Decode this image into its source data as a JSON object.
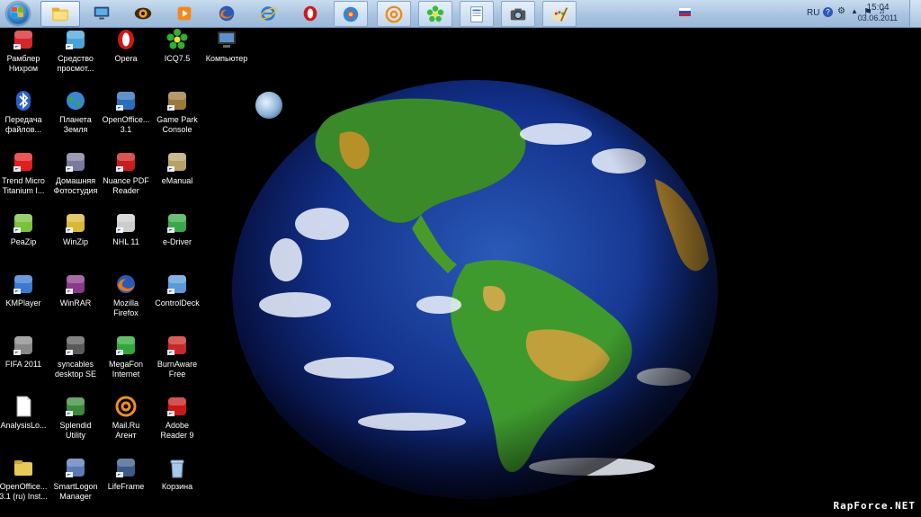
{
  "taskbar": {
    "pinned": [
      {
        "name": "explorer",
        "icon": "folder-icon"
      },
      {
        "name": "display",
        "icon": "monitor-icon"
      },
      {
        "name": "eye",
        "icon": "eye-icon"
      },
      {
        "name": "media",
        "icon": "media-player-icon"
      },
      {
        "name": "firefox",
        "icon": "firefox-icon"
      },
      {
        "name": "ie",
        "icon": "internet-explorer-icon"
      },
      {
        "name": "opera",
        "icon": "opera-icon"
      },
      {
        "name": "games",
        "icon": "game-center-icon"
      },
      {
        "name": "mail",
        "icon": "at-sign-icon"
      },
      {
        "name": "icq",
        "icon": "icq-flower-icon"
      },
      {
        "name": "document",
        "icon": "document-icon"
      },
      {
        "name": "camera",
        "icon": "camera-icon"
      },
      {
        "name": "paint",
        "icon": "palette-icon"
      }
    ]
  },
  "tray": {
    "language": "RU",
    "time": "15:04",
    "date": "03.06.2011"
  },
  "desktop": {
    "icons": [
      {
        "label": "Рамблер\nНихром",
        "icon": "rambler-icon",
        "color": "#d7262a"
      },
      {
        "label": "Средство\nпросмот...",
        "icon": "photo-viewer-icon",
        "color": "#4aa3d8"
      },
      {
        "label": "Opera",
        "icon": "opera-icon",
        "color": "#d01818"
      },
      {
        "label": "ICQ7.5",
        "icon": "icq-flower-icon",
        "color": "#2fb12f"
      },
      {
        "label": "Компьютер",
        "icon": "computer-icon",
        "color": "#5e8fc8"
      },
      {
        "label": "Передача\nфайлов...",
        "icon": "bluetooth-icon",
        "color": "#2a62c8"
      },
      {
        "label": "Планета\nЗемля",
        "icon": "globe-icon",
        "color": "#3a86d6"
      },
      {
        "label": "OpenOffice...\n3.1",
        "icon": "openoffice-icon",
        "color": "#2b6fb8"
      },
      {
        "label": "Game Park\nConsole",
        "icon": "gamepad-icon",
        "color": "#9a7a3a"
      },
      {
        "label": "Trend Micro\nTitanium I...",
        "icon": "trend-micro-icon",
        "color": "#e02020"
      },
      {
        "label": "Домашняя\nФотостудия",
        "icon": "camera-icon",
        "color": "#7a7a9a"
      },
      {
        "label": "Nuance PDF\nReader",
        "icon": "pdf-reader-icon",
        "color": "#c81e1e"
      },
      {
        "label": "eManual",
        "icon": "manual-icon",
        "color": "#b8a068"
      },
      {
        "label": "PeaZip",
        "icon": "peazip-icon",
        "color": "#7ac23a"
      },
      {
        "label": "WinZip",
        "icon": "winzip-icon",
        "color": "#d8b838"
      },
      {
        "label": "NHL 11",
        "icon": "nhl-icon",
        "color": "#cccccc"
      },
      {
        "label": "e-Driver",
        "icon": "e-driver-icon",
        "color": "#3aa84a"
      },
      {
        "label": "KMPlayer",
        "icon": "kmplayer-icon",
        "color": "#3a7ad0"
      },
      {
        "label": "WinRAR",
        "icon": "winrar-icon",
        "color": "#8a3a8a"
      },
      {
        "label": "Mozilla\nFirefox",
        "icon": "firefox-icon",
        "color": "#e87a1a"
      },
      {
        "label": "ControlDeck",
        "icon": "control-deck-icon",
        "color": "#5a9ad8"
      },
      {
        "label": "FIFA 2011",
        "icon": "fifa-icon",
        "color": "#888888"
      },
      {
        "label": "syncables\ndesktop SE",
        "icon": "syncables-icon",
        "color": "#5a5a5a"
      },
      {
        "label": "MegaFon\nInternet",
        "icon": "megafon-icon",
        "color": "#2fa83a"
      },
      {
        "label": "BurnAware\nFree",
        "icon": "burnaware-icon",
        "color": "#c82828"
      },
      {
        "label": "AnalysisLo...",
        "icon": "text-file-icon",
        "color": "#ffffff"
      },
      {
        "label": "Splendid\nUtility",
        "icon": "splendid-icon",
        "color": "#3a8a3a"
      },
      {
        "label": "Mail.Ru\nАгент",
        "icon": "at-sign-icon",
        "color": "#f09020"
      },
      {
        "label": "Adobe\nReader 9",
        "icon": "adobe-reader-icon",
        "color": "#c81818"
      },
      {
        "label": "OpenOffice...\n3.1 (ru) Inst...",
        "icon": "folder-icon",
        "color": "#e8c858"
      },
      {
        "label": "SmartLogon\nManager",
        "icon": "smartlogon-icon",
        "color": "#5a7ab8"
      },
      {
        "label": "LifeFrame",
        "icon": "webcam-icon",
        "color": "#3a5a8a"
      },
      {
        "label": "Корзина",
        "icon": "recycle-bin-icon",
        "color": "#a8c8e8"
      }
    ]
  },
  "watermark": "RapForce.NET"
}
